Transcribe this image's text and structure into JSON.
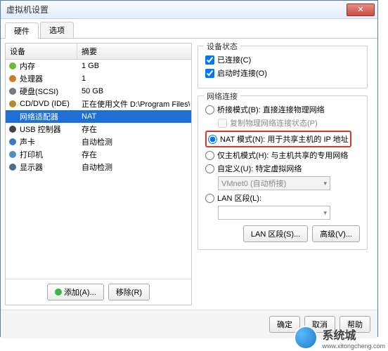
{
  "window": {
    "title": "虚拟机设置"
  },
  "tabs": {
    "hardware": "硬件",
    "options": "选项"
  },
  "columns": {
    "device": "设备",
    "summary": "摘要"
  },
  "devices": [
    {
      "icon": "mem",
      "name": "内存",
      "summary": "1 GB"
    },
    {
      "icon": "cpu",
      "name": "处理器",
      "summary": "1"
    },
    {
      "icon": "disk",
      "name": "硬盘(SCSI)",
      "summary": "50 GB"
    },
    {
      "icon": "cd",
      "name": "CD/DVD (IDE)",
      "summary": "正在使用文件 D:\\Program Files\\VM..."
    },
    {
      "icon": "net",
      "name": "网络适配器",
      "summary": "NAT",
      "selected": true
    },
    {
      "icon": "usb",
      "name": "USB 控制器",
      "summary": "存在"
    },
    {
      "icon": "snd",
      "name": "声卡",
      "summary": "自动检测"
    },
    {
      "icon": "prn",
      "name": "打印机",
      "summary": "存在"
    },
    {
      "icon": "mon",
      "name": "显示器",
      "summary": "自动检测"
    }
  ],
  "leftButtons": {
    "add": "添加(A)...",
    "remove": "移除(R)"
  },
  "status": {
    "groupTitle": "设备状态",
    "connected": "已连接(C)",
    "connectOnPower": "启动时连接(O)"
  },
  "network": {
    "groupTitle": "网络连接",
    "bridged": "桥接模式(B): 直接连接物理网络",
    "replicate": "复制物理网络连接状态(P)",
    "nat": "NAT 模式(N): 用于共享主机的 IP 地址",
    "hostonly": "仅主机模式(H): 与主机共享的专用网络",
    "custom": "自定义(U): 特定虚拟网络",
    "customCombo": "VMnet0 (自动桥接)",
    "lan": "LAN 区段(L):"
  },
  "rightButtons": {
    "lanSegments": "LAN 区段(S)...",
    "advanced": "高级(V)..."
  },
  "dialogButtons": {
    "ok": "确定",
    "cancel": "取消",
    "help": "帮助"
  },
  "watermark": {
    "brand": "系统城",
    "url": "www.xitongcheng.com"
  }
}
